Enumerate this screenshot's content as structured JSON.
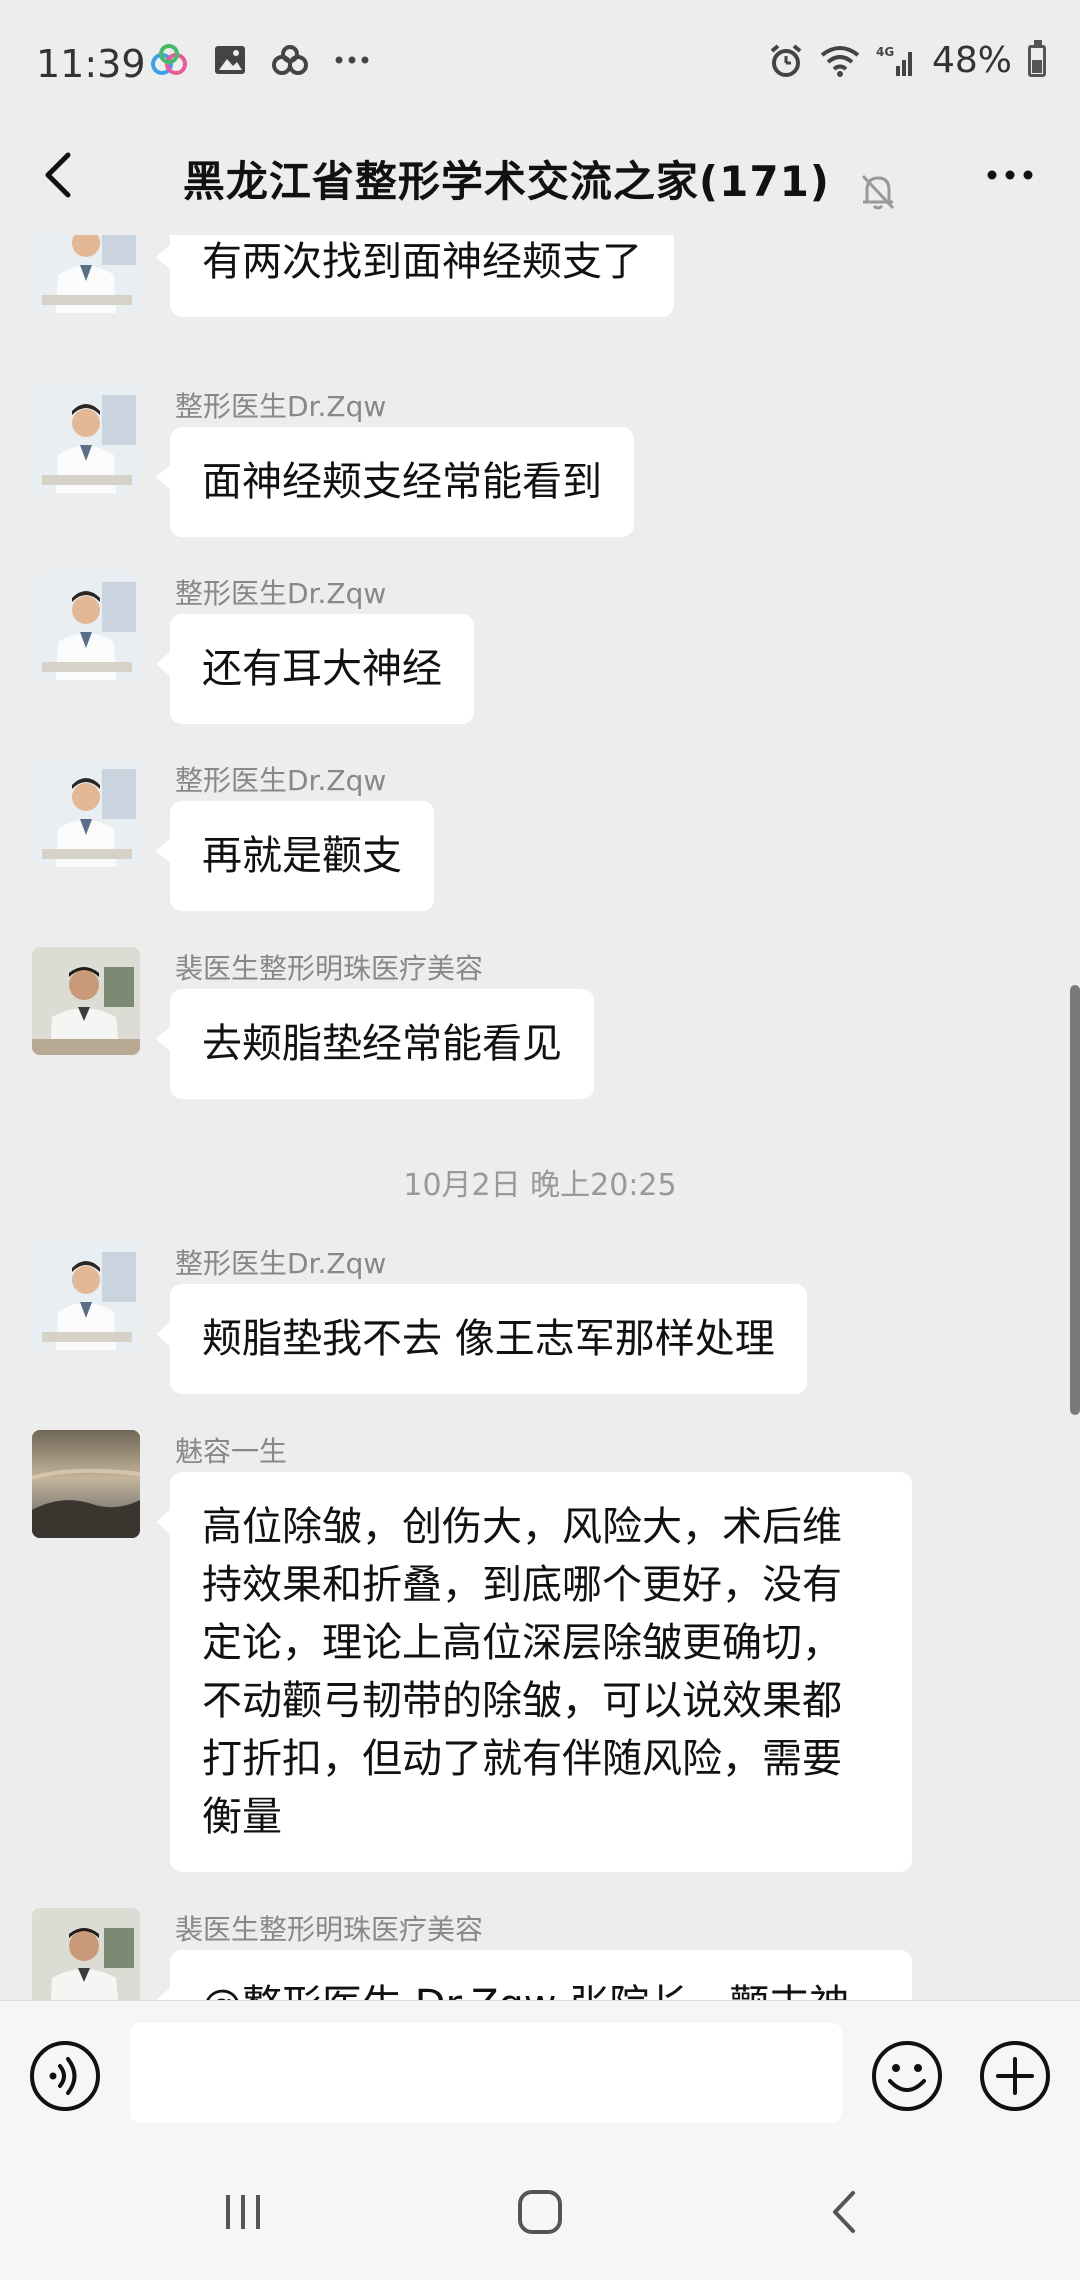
{
  "status_bar": {
    "time": "11:39",
    "network": "4G",
    "battery_percent": "48%",
    "battery_level": 0.48
  },
  "header": {
    "title": "黑龙江省整形学术交流之家(171)"
  },
  "messages": [
    {
      "sender": "",
      "text": "有两次找到面神经颊支了",
      "avatar": "doctor"
    },
    {
      "sender": "整形医生Dr.Zqw",
      "text": "面神经颊支经常能看到",
      "avatar": "doctor"
    },
    {
      "sender": "整形医生Dr.Zqw",
      "text": "还有耳大神经",
      "avatar": "doctor"
    },
    {
      "sender": "整形医生Dr.Zqw",
      "text": "再就是颧支",
      "avatar": "doctor"
    },
    {
      "sender": "裴医生整形明珠医疗美容",
      "text": "去颊脂垫经常能看见",
      "avatar": "pei"
    },
    {
      "timestamp": "10月2日 晚上20:25"
    },
    {
      "sender": "整形医生Dr.Zqw",
      "text": "颊脂垫我不去 像王志军那样处理",
      "avatar": "doctor"
    },
    {
      "sender": "魅容一生",
      "text": "高位除皱，创伤大，风险大，术后维持效果和折叠，到底哪个更好，没有定论，理论上高位深层除皱更确切，不动颧弓韧带的除皱，可以说效果都打折扣，但动了就有伴随风险，需要衡量",
      "avatar": "sky"
    },
    {
      "sender": "裴医生整形明珠医疗美容",
      "text": "@整形医生 Dr.Zqw 张院长，颧支神",
      "avatar": "pei"
    }
  ],
  "input": {
    "placeholder": ""
  },
  "icons": {
    "back": "chevron-left-icon",
    "mute": "bell-off-icon",
    "more": "more-dots-icon",
    "voice": "voice-icon",
    "emoji": "emoji-icon",
    "plus": "plus-icon"
  }
}
